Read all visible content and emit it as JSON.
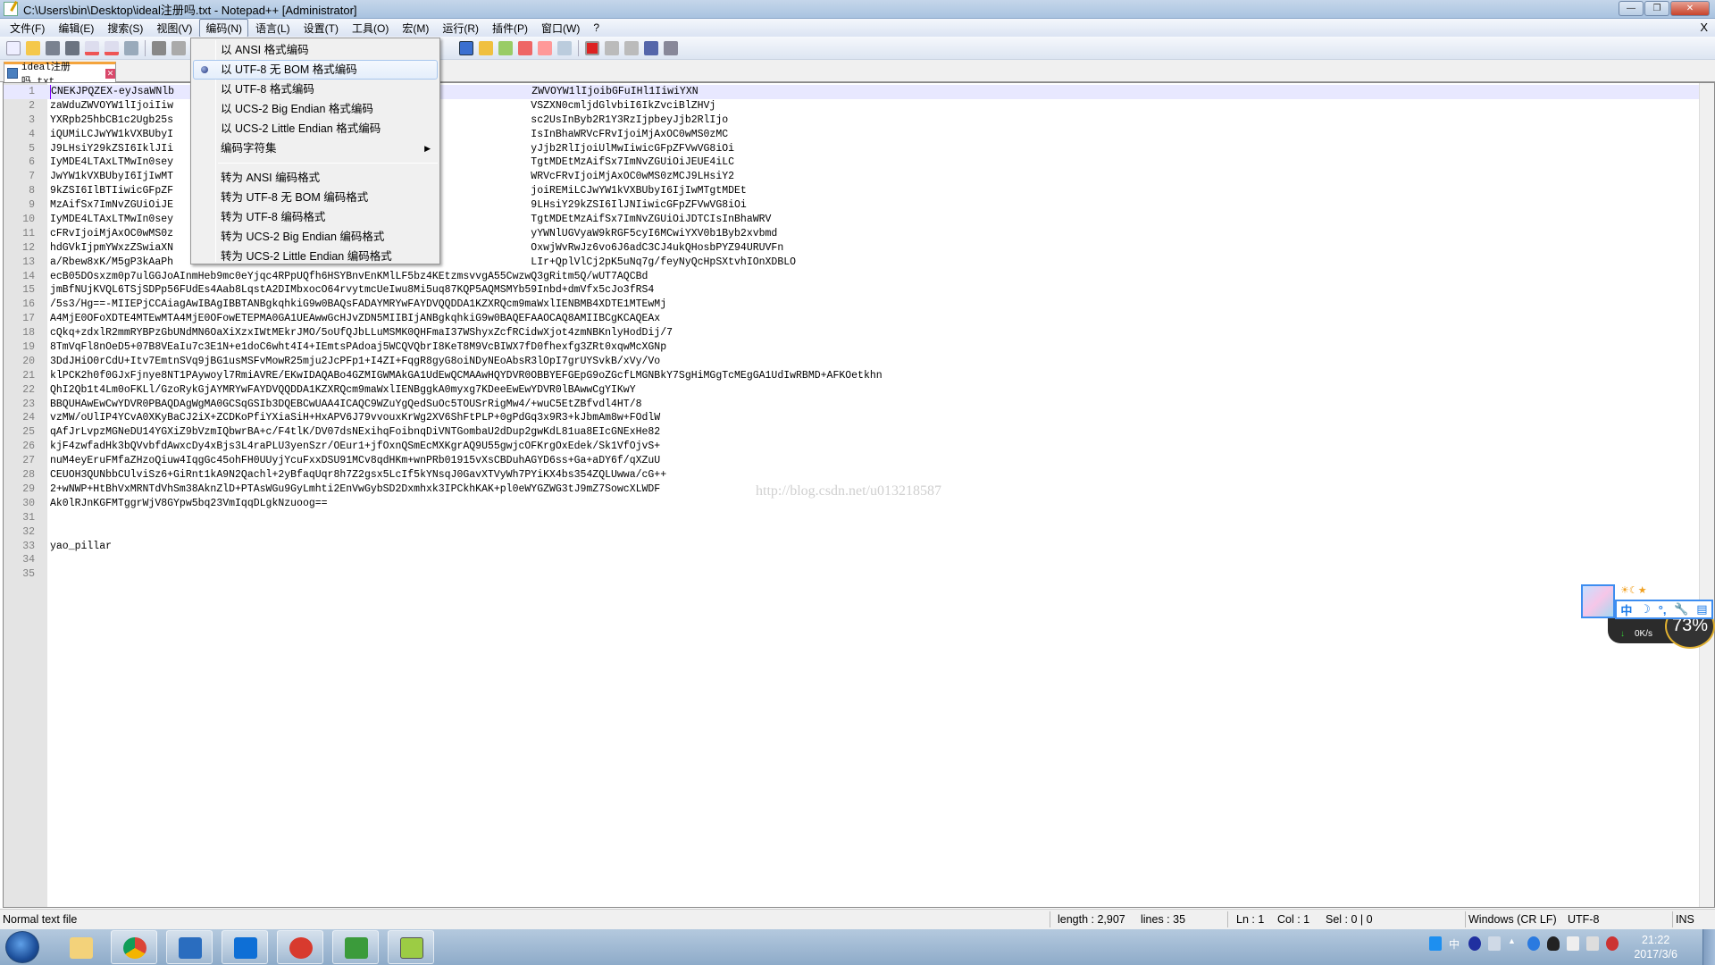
{
  "window": {
    "title": "C:\\Users\\bin\\Desktop\\ideal注册吗.txt - Notepad++ [Administrator]",
    "buttons": {
      "minimize": "—",
      "maximize": "❐",
      "close": "✕"
    }
  },
  "menubar": {
    "items": [
      "文件(F)",
      "编辑(E)",
      "搜索(S)",
      "视图(V)",
      "编码(N)",
      "语言(L)",
      "设置(T)",
      "工具(O)",
      "宏(M)",
      "运行(R)",
      "插件(P)",
      "窗口(W)",
      "?"
    ],
    "active": "编码(N)",
    "close_doc": "X"
  },
  "encoding_menu": {
    "items": [
      {
        "label": "以 ANSI 格式编码",
        "checked": false
      },
      {
        "label": "以 UTF-8 无 BOM 格式编码",
        "checked": true
      },
      {
        "label": "以 UTF-8 格式编码",
        "checked": false
      },
      {
        "label": "以 UCS-2 Big Endian 格式编码",
        "checked": false
      },
      {
        "label": "以 UCS-2 Little Endian 格式编码",
        "checked": false
      },
      {
        "label": "编码字符集",
        "submenu": true
      }
    ],
    "convert_items": [
      "转为 ANSI 编码格式",
      "转为 UTF-8 无 BOM 编码格式",
      "转为 UTF-8 编码格式",
      "转为 UCS-2 Big Endian 编码格式",
      "转为 UCS-2 Little Endian 编码格式"
    ]
  },
  "tab": {
    "label": "ideal注册吗.txt",
    "close": "✕"
  },
  "editor": {
    "watermark": "http://blog.csdn.net/u013218587",
    "lines": [
      "CNEKJPQZEX-eyJsaWNlb                                                          ZWVOYW1lIjoibGFuIHl1IiwiYXN",
      "zaWduZWVOYW1lIjoiIiw                                                          VSZXN0cmljdGlvbiI6IkZvciBlZHVj",
      "YXRpb25hbCB1c2Ugb25s                                                          sc2UsInByb2R1Y3RzIjpbeyJjb2RlIjo",
      "iQUMiLCJwYW1kVXBUbyI                                                          IsInBhaWRVcFRvIjoiMjAxOC0wMS0zMC",
      "J9LHsiY29kZSI6IklJIi                                                          yJjb2RlIjoiUlMwIiwicGFpZFVwVG8iOi",
      "IyMDE4LTAxLTMwIn0sey                                                          TgtMDEtMzAifSx7ImNvZGUiOiJEUE4iLC",
      "JwYW1kVXBUbyI6IjIwMT                                                          WRVcFRvIjoiMjAxOC0wMS0zMCJ9LHsiY2",
      "9kZSI6IlBTIiwicGFpZF                                                          joiREMiLCJwYW1kVXBUbyI6IjIwMTgtMDEt",
      "MzAifSx7ImNvZGUiOiJE                                                          9LHsiY29kZSI6IlJNIiwicGFpZFVwVG8iOi",
      "IyMDE4LTAxLTMwIn0sey                                                          TgtMDEtMzAifSx7ImNvZGUiOiJDTCIsInBhaWRV",
      "cFRvIjoiMjAxOC0wMS0z                                                          yYWNlUGVyaW9kRGF5cyI6MCwiYXV0b1Byb2xvbmd",
      "hdGVkIjpmYWxzZSwiaXN                                                          OxwjWvRwJz6vo6J6adC3CJ4ukQHosbPYZ94URUVFn",
      "a/Rbew8xK/M5gP3kAaPh                                                          LIr+QplVlCj2pK5uNq7g/feyNyQcHpSXtvhIOnXDBLO",
      "ecB05DOsxzm0p7ulGGJoAInmHeb9mc0eYjqc4RPpUQfh6HSYBnvEnKMlLF5bz4KEtzmsvvgA55CwzwQ3gRitm5Q/wUT7AQCBd",
      "jmBfNUjKVQL6TSjSDPp56FUdEs4Aab8LqstA2DIMbxocO64rvytmcUeIwu8Mi5uq87KQP5AQMSMYb59Inbd+dmVfx5cJo3fRS4",
      "/5s3/Hg==-MIIEPjCCAiagAwIBAgIBBTANBgkqhkiG9w0BAQsFADAYMRYwFAYDVQQDDA1KZXRQcm9maWxlIENBMB4XDTE1MTEwMj",
      "A4MjE0OFoXDTE4MTEwMTA4MjE0OFowETEPMA0GA1UEAwwGcHJvZDN5MIIBIjANBgkqhkiG9w0BAQEFAAOCAQ8AMIIBCgKCAQEAx",
      "cQkq+zdxlR2mmRYBPzGbUNdMN6OaXiXzxIWtMEkrJMO/5oUfQJbLLuMSMK0QHFmaI37WShyxZcfRCidwXjot4zmNBKnlyHodDij/7",
      "8TmVqFl8nOeD5+07B8VEaIu7c3E1N+e1doC6wht4I4+IEmtsPAdoaj5WCQVQbrI8KeT8M9VcBIWX7fD0fhexfg3ZRt0xqwMcXGNp",
      "3DdJHiO0rCdU+Itv7EmtnSVq9jBG1usMSFvMowR25mju2JcPFp1+I4ZI+FqgR8gyG8oiNDyNEoAbsR3lOpI7grUYSvkB/xVy/Vo",
      "klPCK2h0f0GJxFjnye8NT1PAywoyl7RmiAVRE/EKwIDAQABo4GZMIGWMAkGA1UdEwQCMAAwHQYDVR0OBBYEFGEpG9oZGcfLMGNBkY7SgHiMGgTcMEgGA1UdIwRBMD+AFKOetkhn",
      "QhI2Qb1t4Lm0oFKLl/GzoRykGjAYMRYwFAYDVQQDDA1KZXRQcm9maWxlIENBggkA0myxg7KDeeEwEwYDVR0lBAwwCgYIKwY",
      "BBQUHAwEwCwYDVR0PBAQDAgWgMA0GCSqGSIb3DQEBCwUAA4ICAQC9WZuYgQedSuOc5TOUSrRigMw4/+wuC5EtZBfvdl4HT/8",
      "vzMW/oUlIP4YCvA0XKyBaCJ2iX+ZCDKoPfiYXiaSiH+HxAPV6J79vvouxKrWg2XV6ShFtPLP+0gPdGq3x9R3+kJbmAm8w+FOdlW",
      "qAfJrLvpzMGNeDU14YGXiZ9bVzmIQbwrBA+c/F4tlK/DV07dsNExihqFoibnqDiVNTGombaU2dDup2gwKdL81ua8EIcGNExHe82",
      "kjF4zwfadHk3bQVvbfdAwxcDy4xBjs3L4raPLU3yenSzr/OEur1+jfOxnQSmEcMXKgrAQ9U55gwjcOFKrgOxEdek/Sk1VfOjvS+",
      "nuM4eyEruFMfaZHzoQiuw4IqgGc45ohFH0UUyjYcuFxxDSU91MCv8qdHKm+wnPRb01915vXsCBDuhAGYD6ss+Ga+aDY6f/qXZuU",
      "CEUOH3QUNbbCUlviSz6+GiRnt1kA9N2Qachl+2yBfaqUqr8h7Z2gsx5LcIf5kYNsqJ0GavXTVyWh7PYiKX4bs354ZQLUwwa/cG++",
      "2+wNWP+HtBhVxMRNTdVhSm38AknZlD+PTAsWGu9GyLmhti2EnVwGybSD2Dxmhxk3IPCkhKAK+pl0eWYGZWG3tJ9mZ7SowcXLWDF",
      "Ak0lRJnKGFMTggrWjV8GYpw5bq23VmIqqDLgkNzuoog==",
      "",
      "",
      "yao_pillar",
      "",
      ""
    ]
  },
  "statusbar": {
    "file_type": "Normal text file",
    "length": "length : 2,907",
    "lines": "lines : 35",
    "ln": "Ln : 1",
    "col": "Col : 1",
    "sel": "Sel : 0 | 0",
    "eol": "Windows (CR LF)",
    "encoding": "UTF-8",
    "mode": "INS"
  },
  "widget": {
    "emotes": "☀☾★",
    "ime_items": [
      "中",
      "☽",
      "°,",
      "🔧",
      "▤"
    ],
    "speed": "0K/s",
    "percent": "73%"
  },
  "taskbar": {
    "apps": [
      "Windows Explorer",
      "Google Chrome",
      "IntelliJ IDEA",
      "TeamViewer",
      "Xshell",
      "Xftp",
      "Notepad++"
    ],
    "tray": [
      "QQ browser",
      "中",
      "help",
      "network",
      "show-hidden",
      "security",
      "QQ",
      "flag",
      "network-status",
      "volume-muted"
    ],
    "time": "21:22",
    "date": "2017/3/6"
  },
  "colors": {
    "tab_accent": "#f4a43c",
    "caret": "#8000ff",
    "current_line": "#e8e8ff"
  }
}
